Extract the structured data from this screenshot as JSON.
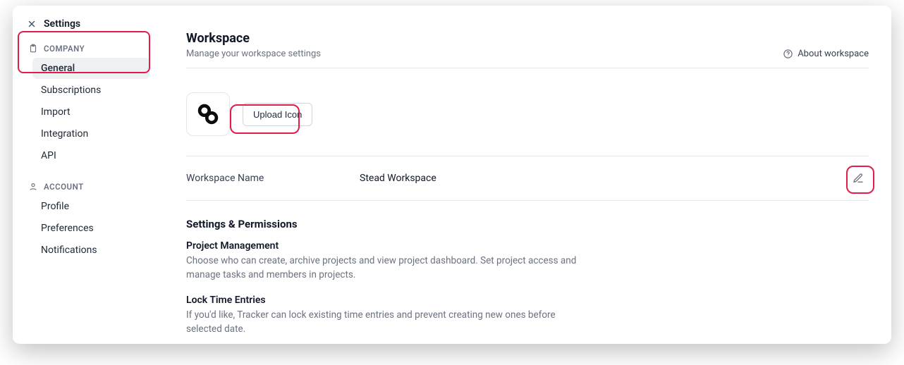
{
  "sidebar": {
    "title": "Settings",
    "sections": [
      {
        "label": "COMPANY",
        "icon": "clipboard-icon",
        "items": [
          {
            "label": "General",
            "active": true
          },
          {
            "label": "Subscriptions",
            "active": false
          },
          {
            "label": "Import",
            "active": false
          },
          {
            "label": "Integration",
            "active": false
          },
          {
            "label": "API",
            "active": false
          }
        ]
      },
      {
        "label": "ACCOUNT",
        "icon": "user-icon",
        "items": [
          {
            "label": "Profile",
            "active": false
          },
          {
            "label": "Preferences",
            "active": false
          },
          {
            "label": "Notifications",
            "active": false
          }
        ]
      }
    ]
  },
  "main": {
    "title": "Workspace",
    "subtitle": "Manage your workspace settings",
    "about_link": "About workspace",
    "upload_button": "Upload Icon",
    "workspace_name_label": "Workspace Name",
    "workspace_name_value": "Stead Workspace",
    "settings_section_header": "Settings & Permissions",
    "settings": [
      {
        "title": "Project Management",
        "desc": "Choose who can create, archive projects and view project dashboard. Set project access and manage tasks and members in projects."
      },
      {
        "title": "Lock Time Entries",
        "desc": "If you'd like, Tracker can lock existing time entries and prevent creating new ones before selected date."
      }
    ]
  }
}
